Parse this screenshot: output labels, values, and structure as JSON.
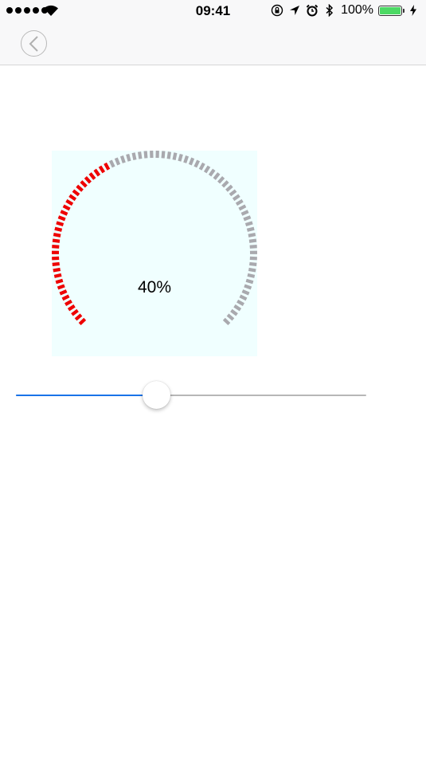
{
  "status_bar": {
    "time": "09:41",
    "battery_text": "100%",
    "battery_color": "#4cd964",
    "icons": [
      "signal-dots",
      "wifi-icon",
      "orientation-lock-icon",
      "location-arrow-icon",
      "alarm-icon",
      "bluetooth-icon",
      "battery-icon",
      "charging-bolt-icon"
    ]
  },
  "nav": {
    "back_icon": "chevron-left-icon"
  },
  "gauge": {
    "label": "40%",
    "value": 0.4,
    "active_color": "#ee0000",
    "inactive_color": "#a9a9ae",
    "background": "#f0ffff"
  },
  "slider": {
    "value": 0.4,
    "fill_color": "#1a73e8",
    "track_color": "#b7b7b7"
  }
}
